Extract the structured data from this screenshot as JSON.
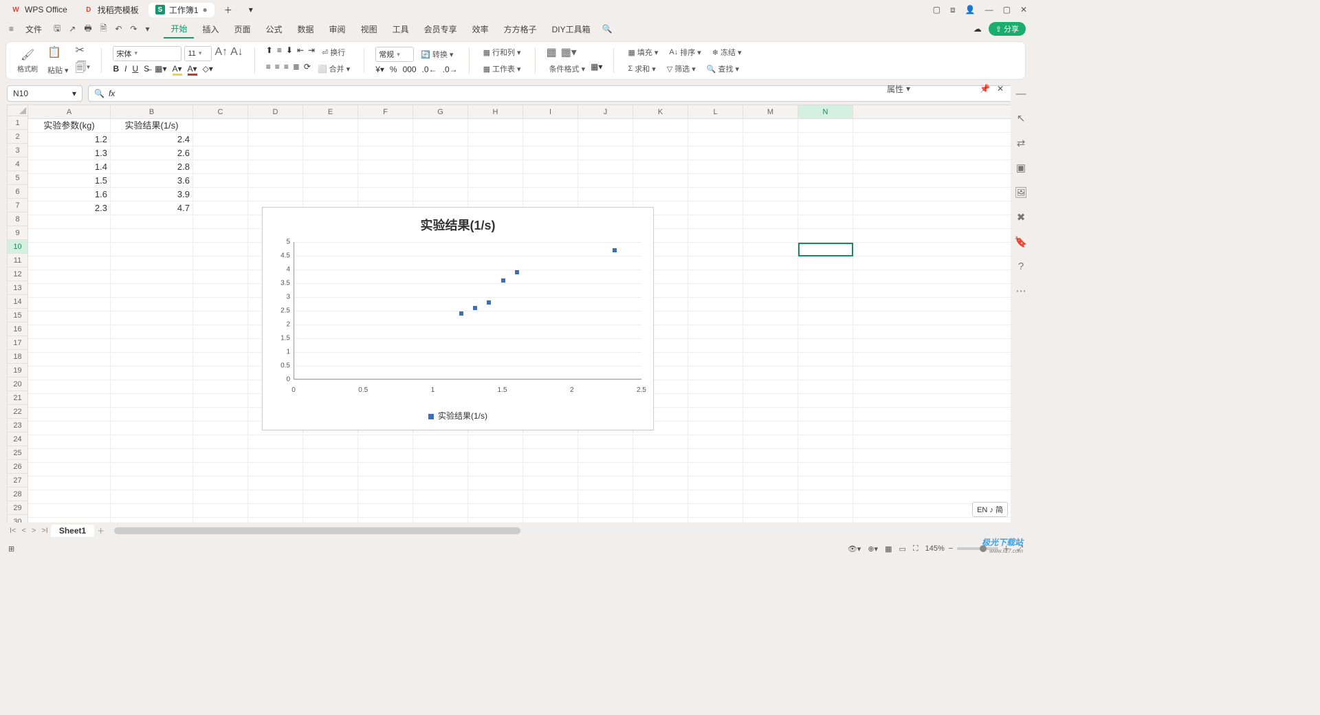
{
  "titlebar": {
    "tabs": [
      {
        "icon": "W",
        "icolor": "#d14b3d",
        "label": "WPS Office"
      },
      {
        "icon": "D",
        "icolor": "#d14b3d",
        "label": "找稻壳模板"
      },
      {
        "icon": "S",
        "icolor": "#1a936f",
        "label": "工作簿1",
        "active": true,
        "dirty": "●"
      }
    ],
    "add": "＋",
    "dd": "▾"
  },
  "menu": {
    "file": "文件",
    "items": [
      "开始",
      "插入",
      "页面",
      "公式",
      "数据",
      "审阅",
      "视图",
      "工具",
      "会员专享",
      "效率",
      "方方格子",
      "DIY工具箱"
    ],
    "active": 0,
    "share": "分享"
  },
  "ribbon": {
    "fmtbrush": "格式刷",
    "paste": "粘贴",
    "font": "宋体",
    "size": "11",
    "numfmt": "常规",
    "convert": "转换",
    "rowcol": "行和列",
    "wrap": "换行",
    "merge": "合并",
    "worksheet": "工作表",
    "condfmt": "条件格式",
    "fill": "填充",
    "sort": "排序",
    "freeze": "冻结",
    "sum": "求和",
    "filter": "筛选",
    "find": "查找"
  },
  "namebox": "N10",
  "fx": "fx",
  "columns": [
    "A",
    "B",
    "C",
    "D",
    "E",
    "F",
    "G",
    "H",
    "I",
    "J",
    "K",
    "L",
    "M",
    "N"
  ],
  "rows": 30,
  "data": {
    "A1": "实验参数(kg)",
    "B1": "实验结果(1/s)",
    "A2": "1.2",
    "B2": "2.4",
    "A3": "1.3",
    "B3": "2.6",
    "A4": "1.4",
    "B4": "2.8",
    "A5": "1.5",
    "B5": "3.6",
    "A6": "1.6",
    "B6": "3.9",
    "A7": "2.3",
    "B7": "4.7"
  },
  "active": {
    "col": "N",
    "row": 10
  },
  "chart_data": {
    "type": "scatter",
    "title": "实验结果(1/s)",
    "series": [
      {
        "name": "实验结果(1/s)",
        "x": [
          1.2,
          1.3,
          1.4,
          1.5,
          1.6,
          2.3
        ],
        "y": [
          2.4,
          2.6,
          2.8,
          3.6,
          3.9,
          4.7
        ]
      }
    ],
    "xlim": [
      0,
      2.5
    ],
    "ylim": [
      0,
      5
    ],
    "xticks": [
      0,
      0.5,
      1,
      1.5,
      2,
      2.5
    ],
    "yticks": [
      0,
      0.5,
      1,
      1.5,
      2,
      2.5,
      3,
      3.5,
      4,
      4.5,
      5
    ]
  },
  "sheet": {
    "name": "Sheet1",
    "add": "＋"
  },
  "prop": {
    "label": "属性"
  },
  "status": {
    "zoom": "145%",
    "ime": "EN ♪ 简"
  },
  "watermark": {
    "t1": "极光下载站",
    "t2": "www.xz7.com"
  }
}
